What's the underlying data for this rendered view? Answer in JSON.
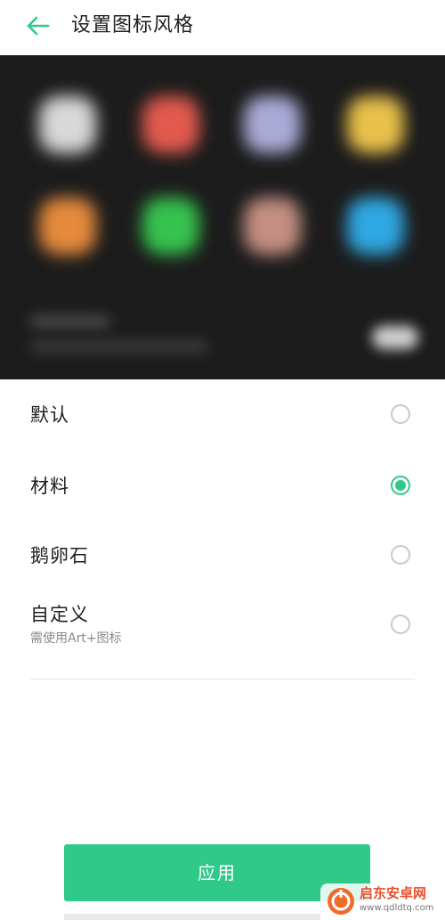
{
  "header": {
    "title": "设置图标风格",
    "back_icon": "back-arrow-icon",
    "accent_color": "#2fc98a"
  },
  "preview": {
    "description": "blurred icon preview",
    "icon_colors": [
      "#d8d8d8",
      "#e25a4e",
      "#a9abd6",
      "#e9c04a",
      "#e58a3c",
      "#36c24f",
      "#c48f82",
      "#2fa8e2"
    ]
  },
  "options": [
    {
      "label": "默认",
      "sub": "",
      "selected": false
    },
    {
      "label": "材料",
      "sub": "",
      "selected": true
    },
    {
      "label": "鹅卵石",
      "sub": "",
      "selected": false
    },
    {
      "label": "自定义",
      "sub": "需使用Art+图标",
      "selected": false
    }
  ],
  "apply_button": {
    "label": "应用"
  },
  "watermark": {
    "name": "启东安卓网",
    "url": "www.qdldtq.com"
  }
}
